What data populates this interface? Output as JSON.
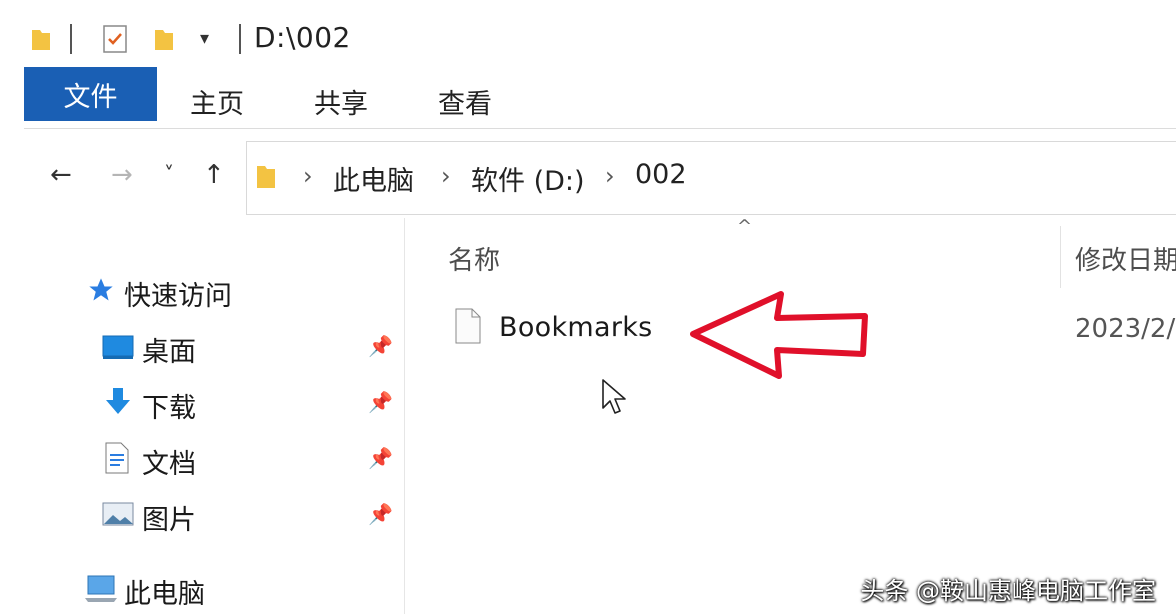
{
  "titlebar": {
    "path": "D:\\002"
  },
  "ribbon": {
    "tabs": [
      "文件",
      "主页",
      "共享",
      "查看"
    ]
  },
  "nav": {
    "back": "←",
    "forward": "→",
    "recent": "˅",
    "up": "↑"
  },
  "breadcrumb": {
    "items": [
      "此电脑",
      "软件 (D:)",
      "002"
    ],
    "separator": "›"
  },
  "columns": {
    "name": "名称",
    "modified": "修改日期"
  },
  "sidebar": {
    "quick_access": "快速访问",
    "items": [
      {
        "label": "桌面",
        "icon": "desktop-icon",
        "pinned": true
      },
      {
        "label": "下载",
        "icon": "download-icon",
        "pinned": true
      },
      {
        "label": "文档",
        "icon": "document-icon",
        "pinned": true
      },
      {
        "label": "图片",
        "icon": "pictures-icon",
        "pinned": true
      }
    ],
    "this_pc": "此电脑"
  },
  "files": [
    {
      "name": "Bookmarks",
      "modified": "2023/2/"
    }
  ],
  "watermark": "头条 @鞍山惠峰电脑工作室",
  "colors": {
    "file_tab": "#1a5fb4",
    "annotation_arrow": "#e0102a"
  }
}
